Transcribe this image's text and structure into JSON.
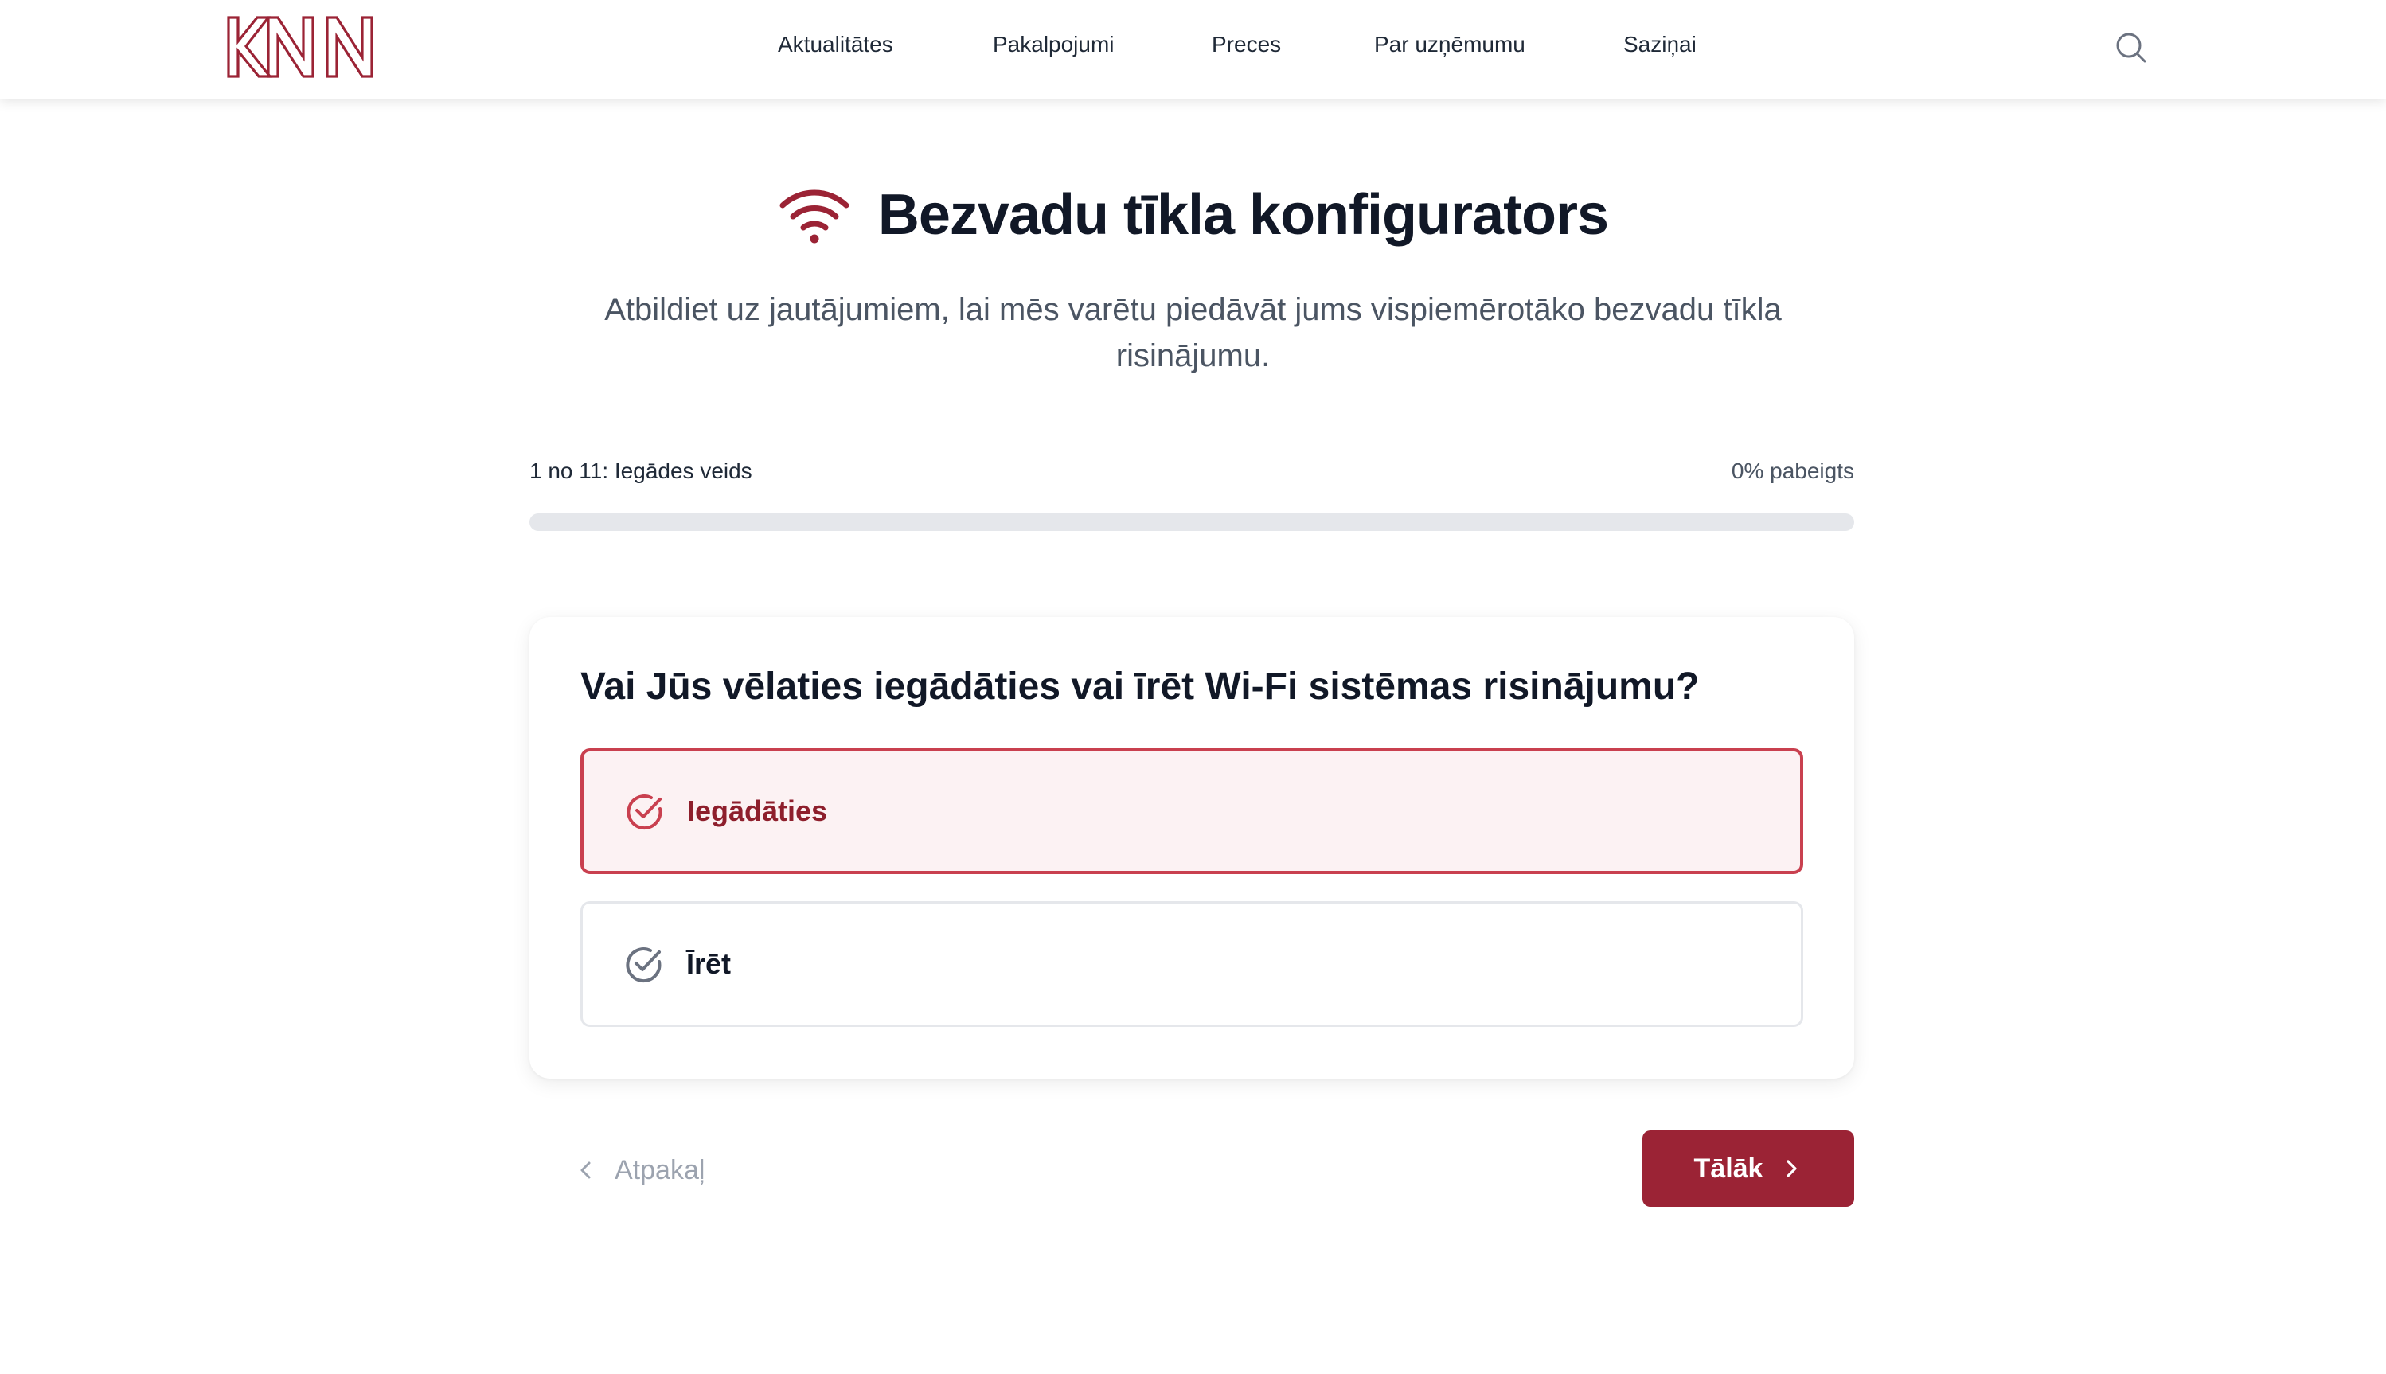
{
  "header": {
    "logo_text": "KNN",
    "nav": [
      {
        "label": "Aktualitātes"
      },
      {
        "label": "Pakalpojumi"
      },
      {
        "label": "Preces"
      },
      {
        "label": "Par uzņēmumu"
      },
      {
        "label": "Saziņai"
      }
    ],
    "search_icon": "search-icon"
  },
  "hero": {
    "icon": "wifi-icon",
    "title": "Bezvadu tīkla konfigurators",
    "subtitle": "Atbildiet uz jautājumiem, lai mēs varētu piedāvāt jums vispiemērotāko bezvadu tīkla risinājumu."
  },
  "progress": {
    "step_label": "1 no 11: Iegādes veids",
    "percent_label": "0% pabeigts",
    "percent": 0
  },
  "question": {
    "text": "Vai Jūs vēlaties iegādāties vai īrēt Wi-Fi sistēmas risinājumu?",
    "options": [
      {
        "label": "Iegādāties",
        "selected": true
      },
      {
        "label": "Īrēt",
        "selected": false
      }
    ]
  },
  "navigation": {
    "back_label": "Atpakaļ",
    "next_label": "Tālāk"
  },
  "colors": {
    "brand": "#9b2335",
    "selected_border": "#c9404f",
    "selected_bg": "#fcf2f3",
    "muted": "#9ca3af"
  }
}
